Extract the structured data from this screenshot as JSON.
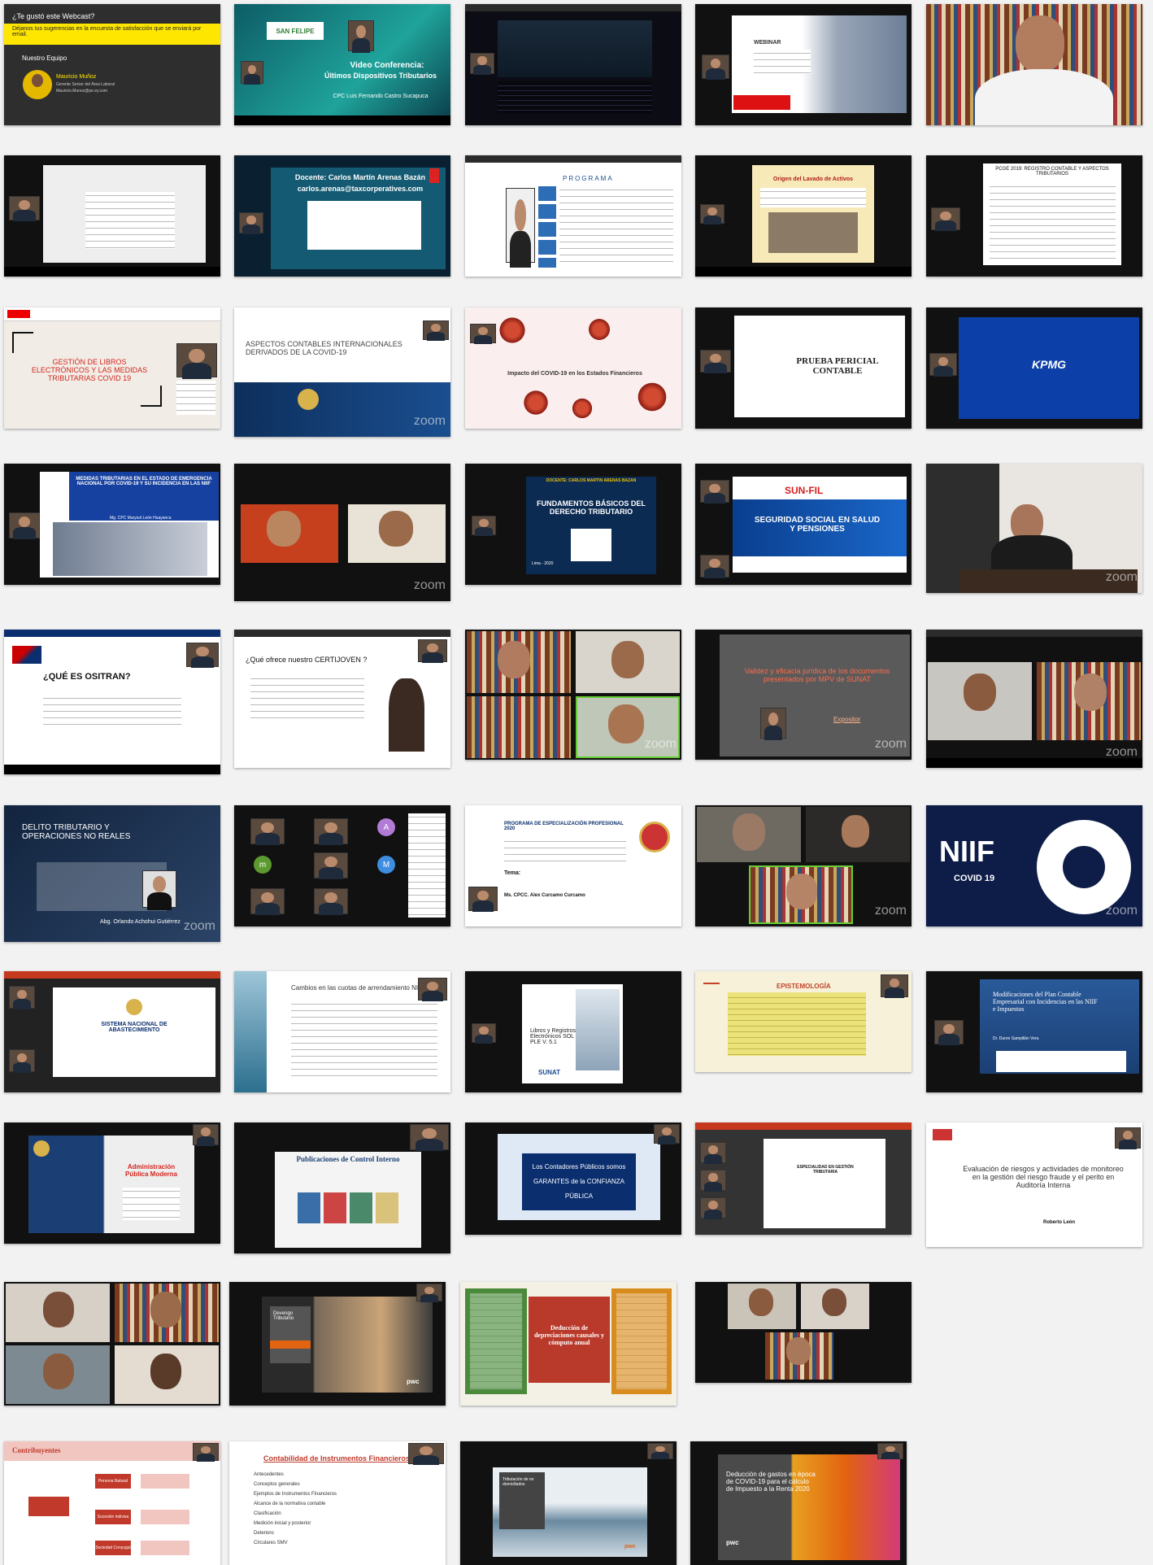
{
  "tiles": {
    "webcast": {
      "question": "¿Te gustó este Webcast?",
      "survey": "Déjanos tus sugerencias en la encuesta de satisfacción que se enviará por email.",
      "team": "Nuestro Equipo",
      "name": "Mauricio Muñoz",
      "role": "Gerente Senior del Área Laboral",
      "email": "Mauricio.Munoz@pe.ey.com"
    },
    "video_conf": {
      "org": "SAN FELIPE",
      "title": "Video Conferencia:",
      "subtitle": "Últimos Dispositivos Tributarios",
      "speaker": "CPC Luis Fernando Castro Sucapuca"
    },
    "webinar": {
      "label": "WEBINAR"
    },
    "docente": {
      "name": "Docente: Carlos Martín Arenas Bazán",
      "email": "carlos.arenas@taxcorperatives.com"
    },
    "programa": {
      "title": "PROGRAMA"
    },
    "lavado": {
      "title": "Origen del Lavado de Activos"
    },
    "pcge": {
      "title": "PCGE 2019: REGISTRO CONTABLE Y ASPECTOS TRIBUTARIOS"
    },
    "libros_e": {
      "title": "GESTIÓN DE LIBROS ELECTRÓNICOS Y LAS MEDIDAS TRIBUTARIAS COVID 19"
    },
    "aspectos": {
      "title": "ASPECTOS CONTABLES INTERNACIONALES DERIVADOS DE LA COVID-19"
    },
    "impacto": {
      "title": "Impacto del COVID-19 en los Estados Financieros"
    },
    "pericia": {
      "title": "PRUEBA PERICIAL CONTABLE"
    },
    "kpmg": {
      "logo": "KPMG"
    },
    "medidas": {
      "title": "MEDIDAS TRIBUTARIAS EN EL ESTADO DE EMERGENCIA NACIONAL POR COVID-19 Y SU INCIDENCIA EN LAS NIIF",
      "author": "Mg. CPC Marysol León Huayanca"
    },
    "fundamentos": {
      "docente": "DOCENTE: CARLOS MARTIN ARENAS BAZAN",
      "title": "FUNDAMENTOS BÁSICOS DEL DERECHO TRIBUTARIO",
      "place": "Lima - 2020"
    },
    "seguridad": {
      "logo": "SUN-FIL",
      "title": "SEGURIDAD SOCIAL EN SALUD Y PENSIONES"
    },
    "ositran": {
      "title": "¿QUÉ ES OSITRAN?"
    },
    "certijoven": {
      "title": "¿Qué ofrece nuestro CERTIJOVEN ?"
    },
    "validez": {
      "title": "Validez y eficacia jurídica de los documentos presentados por MPV de SUNAT",
      "label": "Expositor"
    },
    "delito": {
      "title": "DELITO TRIBUTARIO Y OPERACIONES NO REALES",
      "author": "Abg. Orlando Achohui Gutiérrez"
    },
    "especializacion": {
      "title": "PROGRAMA DE ESPECIALIZACIÓN PROFESIONAL 2020",
      "tema": "Tema:",
      "authors": "Ms. CPCC. Alex Curcamo Curcamo"
    },
    "niif": {
      "title": "NIIF",
      "sub": "COVID 19"
    },
    "abastecimiento": {
      "title": "SISTEMA NACIONAL DE ABASTECIMIENTO"
    },
    "arrendamiento": {
      "title": "Cambios en las cuotas de arrendamiento NIIF"
    },
    "libros_ple": {
      "title": "Libros y Registros Electrónicos SOL y PLE V. 5.1",
      "logo": "SUNAT"
    },
    "epistemologia": {
      "title": "EPISTEMOLOGÍA"
    },
    "plan": {
      "title": "Modificaciones del Plan Contable Empresarial con Incidencias en las NIIF e Impuestos",
      "author": "Dr. Dunre Sampillán Vera"
    },
    "admin": {
      "title": "Administración Pública Moderna"
    },
    "control": {
      "title": "Publicaciones de Control Interno"
    },
    "contadores": {
      "title": "Los Contadores Públicos somos GARANTES de la CONFIANZA PÚBLICA"
    },
    "gestion_trib": {
      "title": "ESPECIALIDAD EN GESTIÓN TRIBUTARIA"
    },
    "riesgos": {
      "title": "Evaluación de riesgos y actividades de monitoreo en la gestión del riesgo fraude y el perito en Auditoría Interna",
      "author": "Roberto León"
    },
    "devengo": {
      "title": "Devengo Tributario",
      "logo": "pwc"
    },
    "deduccion": {
      "title": "Deducción de depreciaciones causales y cómputo anual"
    },
    "contribuyentes": {
      "title": "Contribuyentes",
      "n1": "Persona Natural",
      "n2": "Sucesión indivisa",
      "n3": "Sociedad Conyugal"
    },
    "instrumentos": {
      "title": "Contabilidad de Instrumentos Financieros",
      "items": [
        "Antecedentes",
        "Conceptos generales",
        "Ejemplos de Instrumentos Financieros",
        "Alcance de la normativa contable",
        "Clasificación",
        "Medición inicial y posterior",
        "Deterioro",
        "Circulares SMV"
      ]
    },
    "tributacion": {
      "title": "Tributación de no domiciliados",
      "logo": "pwc"
    },
    "gastos": {
      "title": "Deducción de gastos en época de COVID-19 para el cálculo de Impuesto a la Renta 2020",
      "logo": "pwc"
    }
  },
  "zoom_label": "zoom"
}
